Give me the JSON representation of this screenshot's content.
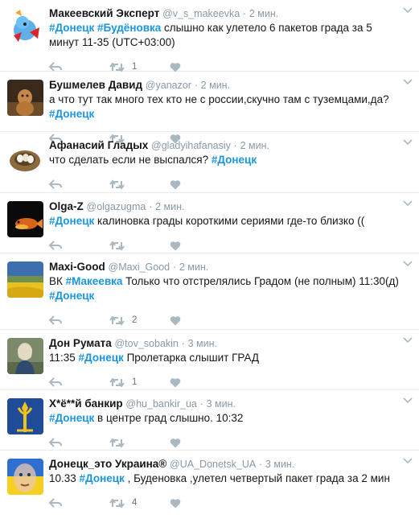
{
  "tweets": [
    {
      "fullname": "Макеевский Эксперт",
      "username": "@v_s_makeevka",
      "time": "2 мин.",
      "segments": [
        {
          "t": "#Донецк",
          "tag": true
        },
        {
          "t": " ",
          "tag": false
        },
        {
          "t": "#Будёновка",
          "tag": true
        },
        {
          "t": " слышно как улетело 6 пакетов града за 5 минут 11-35 (UTC+03:00)",
          "tag": false
        }
      ],
      "retweets": "1",
      "likes": ""
    },
    {
      "fullname": "Бушмелев Давид",
      "username": "@yanazor",
      "time": "2 мин.",
      "segments": [
        {
          "t": "а что тут так много тех кто не с россии,скучно там с туземцами,да? ",
          "tag": false
        },
        {
          "t": "#Донецк",
          "tag": true
        }
      ],
      "retweets": "",
      "likes": ""
    },
    {
      "fullname": "Афанасий Гладых",
      "username": "@gladyihafanasiy",
      "time": "2 мин.",
      "segments": [
        {
          "t": "что сделать если не выспался? ",
          "tag": false
        },
        {
          "t": "#Донецк",
          "tag": true
        }
      ],
      "retweets": "",
      "likes": ""
    },
    {
      "fullname": "Olga-Z",
      "username": "@olgazugma",
      "time": "2 мин.",
      "segments": [
        {
          "t": "#Донецк",
          "tag": true
        },
        {
          "t": " калиновка грады короткими сериями где-то близко ((",
          "tag": false
        }
      ],
      "retweets": "",
      "likes": ""
    },
    {
      "fullname": "Maxi-Good",
      "username": "@Maxi_Good",
      "time": "2 мин.",
      "segments": [
        {
          "t": "ВК ",
          "tag": false
        },
        {
          "t": "#Макеевка",
          "tag": true
        },
        {
          "t": " Только что отстрелялись Градом (не полным) 11:30(д) ",
          "tag": false
        },
        {
          "t": "#Донецк",
          "tag": true
        }
      ],
      "retweets": "2",
      "likes": ""
    },
    {
      "fullname": "Дон Румата",
      "username": "@tov_sobakin",
      "time": "3 мин.",
      "segments": [
        {
          "t": "11:35 ",
          "tag": false
        },
        {
          "t": "#Донецк",
          "tag": true
        },
        {
          "t": " Пролетарка слышит ГРАД",
          "tag": false
        }
      ],
      "retweets": "1",
      "likes": ""
    },
    {
      "fullname": "Х*ё**й банкир",
      "username": "@hu_bankir_ua",
      "time": "3 мин.",
      "segments": [
        {
          "t": "#Донецк",
          "tag": true
        },
        {
          "t": " в центре град слышно. 10:32",
          "tag": false
        }
      ],
      "retweets": "",
      "likes": ""
    },
    {
      "fullname": "Донецк_это Украина®",
      "username": "@UA_Donetsk_UA",
      "time": "3 мин.",
      "segments": [
        {
          "t": "10.33 ",
          "tag": false
        },
        {
          "t": "#Донецк",
          "tag": true
        },
        {
          "t": " , Буденовка ,улетел четвертый пакет града за 2 мин",
          "tag": false
        }
      ],
      "retweets": "4",
      "likes": ""
    }
  ],
  "ui": {
    "separator": "·",
    "icons": [
      "reply-icon",
      "retweet-icon",
      "like-icon",
      "caret-down-icon"
    ],
    "colors": {
      "hashtag": "#1b95e0",
      "meta": "#8899a6",
      "action": "#aab8c2",
      "divider": "#e6ecf0"
    }
  }
}
